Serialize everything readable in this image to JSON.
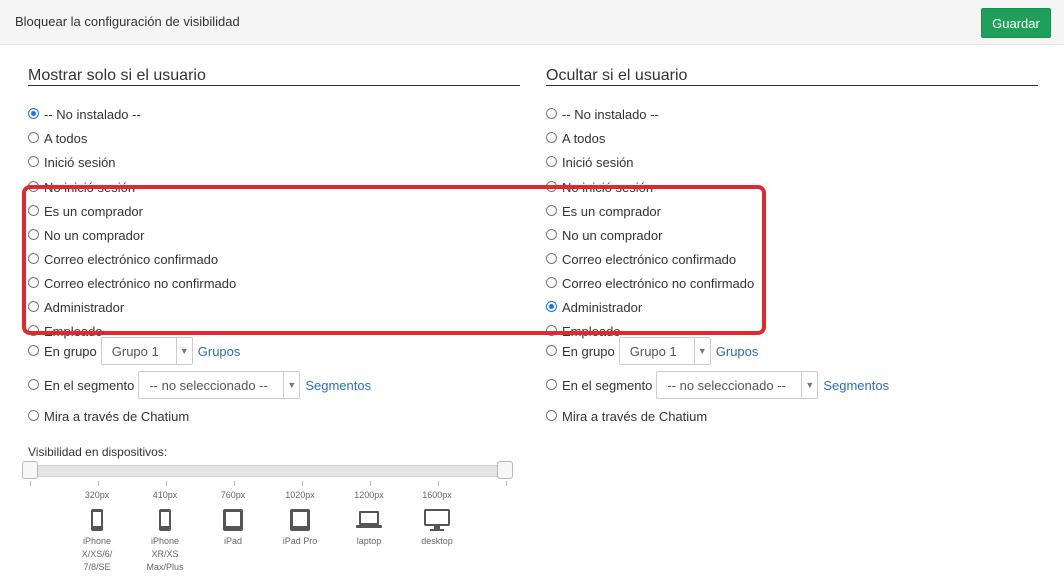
{
  "header": {
    "title": "Bloquear la configuración de visibilidad",
    "save_label": "Guardar"
  },
  "left": {
    "heading": "Mostrar solo si el usuario",
    "options": [
      {
        "label": "-- No instalado --",
        "checked": true
      },
      {
        "label": "A todos",
        "checked": false
      },
      {
        "label": "Inició sesión",
        "checked": false
      },
      {
        "label": "No inició sesión",
        "checked": false
      },
      {
        "label": "Es un comprador",
        "checked": false
      },
      {
        "label": "No un comprador",
        "checked": false
      },
      {
        "label": "Correo electrónico confirmado",
        "checked": false
      },
      {
        "label": "Correo electrónico no confirmado",
        "checked": false
      },
      {
        "label": "Administrador",
        "checked": false
      },
      {
        "label": "Empleado",
        "checked": false
      }
    ],
    "group": {
      "label": "En grupo",
      "select_value": "Grupo 1",
      "link": "Grupos",
      "checked": false
    },
    "segment": {
      "label": "En el segmento",
      "select_value": "-- no seleccionado --",
      "link": "Segmentos",
      "checked": false
    },
    "chatium": {
      "label": "Mira a través de Chatium",
      "checked": false
    }
  },
  "right": {
    "heading": "Ocultar si el usuario",
    "options": [
      {
        "label": "-- No instalado --",
        "checked": false
      },
      {
        "label": "A todos",
        "checked": false
      },
      {
        "label": "Inició sesión",
        "checked": false
      },
      {
        "label": "No inició sesión",
        "checked": false
      },
      {
        "label": "Es un comprador",
        "checked": false
      },
      {
        "label": "No un comprador",
        "checked": false
      },
      {
        "label": "Correo electrónico confirmado",
        "checked": false
      },
      {
        "label": "Correo electrónico no confirmado",
        "checked": false
      },
      {
        "label": "Administrador",
        "checked": true
      },
      {
        "label": "Empleado",
        "checked": false
      }
    ],
    "group": {
      "label": "En grupo",
      "select_value": "Grupo 1",
      "link": "Grupos",
      "checked": false
    },
    "segment": {
      "label": "En el segmento",
      "select_value": "-- no seleccionado --",
      "link": "Segmentos",
      "checked": false
    },
    "chatium": {
      "label": "Mira a través de Chatium",
      "checked": false
    }
  },
  "devices": {
    "label": "Visibilidad en dispositivos:",
    "items": [
      {
        "res": "320px",
        "name": "iPhone\nX/XS/6/\n7/8/SE",
        "icon": "phone-icon"
      },
      {
        "res": "410px",
        "name": "iPhone\nXR/XS\nMax/Plus",
        "icon": "phone-icon"
      },
      {
        "res": "760px",
        "name": "iPad",
        "icon": "tablet-icon"
      },
      {
        "res": "1020px",
        "name": "iPad Pro",
        "icon": "tablet-icon"
      },
      {
        "res": "1200px",
        "name": "laptop",
        "icon": "laptop-icon"
      },
      {
        "res": "1600px",
        "name": "desktop",
        "icon": "desktop-icon"
      }
    ]
  },
  "colors": {
    "accent": "#1fa05a",
    "link": "#2a6ebb",
    "highlight": "#e0282e",
    "radio_checked": "#1a73e8"
  }
}
